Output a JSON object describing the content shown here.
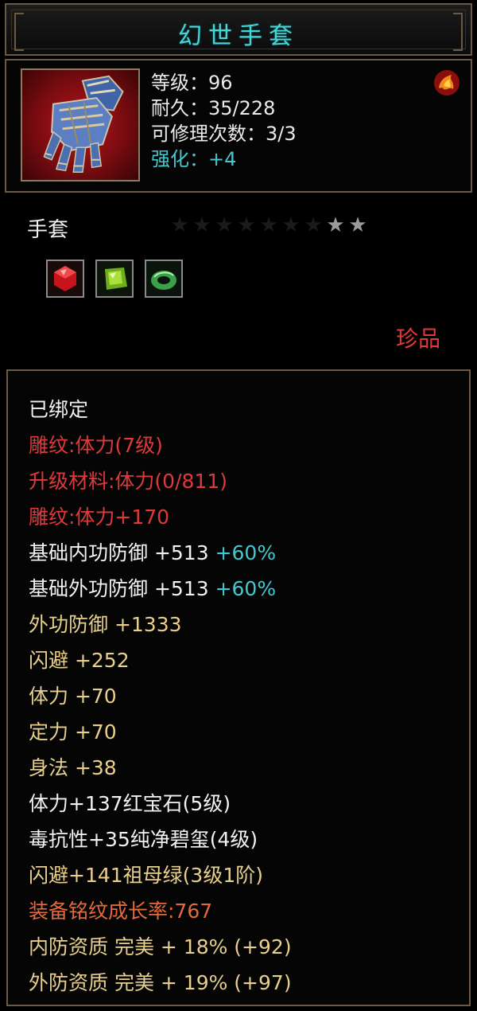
{
  "title": "幻世手套",
  "header": {
    "level": "等级：96",
    "durability": "耐久：35/228",
    "repair": "可修理次数：3/3",
    "enhance": "强化：+4"
  },
  "icons": {
    "item": "gauntlet-icon",
    "badge": "fire-crest-icon",
    "gems": [
      "ruby-gem-icon",
      "peridot-gem-icon",
      "jade-ring-gem-icon"
    ]
  },
  "item_type": "手套",
  "stars": {
    "total": 9,
    "lit": 2
  },
  "quality": "珍品",
  "attributes": [
    {
      "text": "已绑定",
      "color": "white"
    },
    {
      "text": "雕纹:体力(7级)",
      "color": "red"
    },
    {
      "text": "升级材料:体力(0/811)",
      "color": "red"
    },
    {
      "text": "雕纹:体力+170",
      "color": "red"
    },
    {
      "text": "基础内功防御 +513",
      "extra": " +60%",
      "color": "white"
    },
    {
      "text": "基础外功防御 +513",
      "extra": " +60%",
      "color": "white"
    },
    {
      "text": "外功防御 +1333",
      "color": "gold"
    },
    {
      "text": "闪避 +252",
      "color": "gold"
    },
    {
      "text": "体力 +70",
      "color": "gold"
    },
    {
      "text": "定力 +70",
      "color": "gold"
    },
    {
      "text": "身法 +38",
      "color": "gold"
    },
    {
      "text": "体力+137红宝石(5级)",
      "color": "white"
    },
    {
      "text": "毒抗性+35纯净碧玺(4级)",
      "color": "white"
    },
    {
      "text": "闪避+141祖母绿(3级1阶)",
      "color": "gold"
    },
    {
      "text": "装备铭纹成长率:767",
      "color": "orange"
    },
    {
      "text": "内防资质 完美 + 18% (+92)",
      "color": "gold"
    },
    {
      "text": "外防资质 完美 + 19% (+97)",
      "color": "gold"
    }
  ],
  "colors": {
    "title": "#47d6d8",
    "white": "#f2f2f2",
    "red": "#e0393b",
    "gold": "#e8cf8c",
    "orange": "#e16a3f",
    "cyan": "#43c8d0",
    "border": "#6b5a43"
  }
}
